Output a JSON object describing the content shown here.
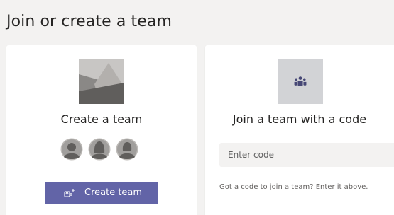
{
  "header": {
    "title": "Join or create a team"
  },
  "create_card": {
    "title": "Create a team",
    "button_label": "Create team",
    "image_icon": "team-landscape-image",
    "button_icon": "team-add-icon"
  },
  "join_card": {
    "title": "Join a team with a code",
    "input_placeholder": "Enter code",
    "input_value": "",
    "hint": "Got a code to join a team? Enter it above.",
    "image_icon": "people-group-icon"
  },
  "colors": {
    "accent": "#6264a7",
    "background": "#f3f2f1",
    "card": "#ffffff"
  }
}
